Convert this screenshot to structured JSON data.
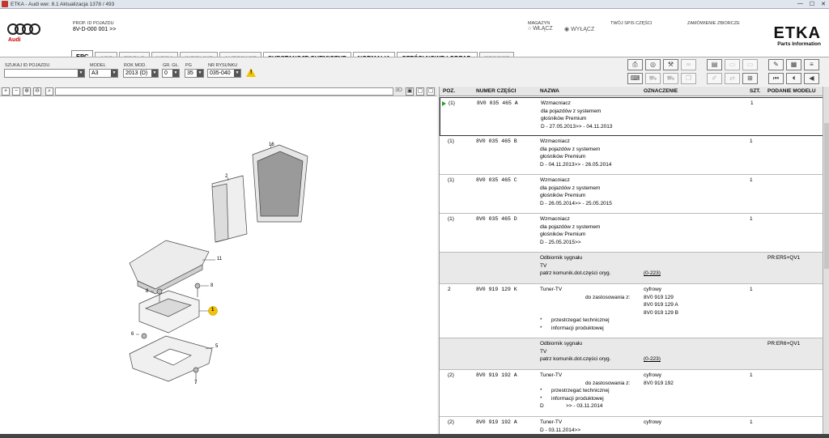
{
  "window": {
    "title": "ETKA - Audi wer. 8.1 Aktualizacja 1378 / 493",
    "controls": [
      "—",
      "☐",
      "✕"
    ]
  },
  "brand": {
    "audi": "Audi",
    "etka": "ETKA",
    "etka_sub": "Parts Information"
  },
  "header": {
    "prop_label": "PROP. ID POJAZDU",
    "prop_value": "8V-D-000 001 >>",
    "magazyn_label": "MAGAZYN",
    "wlacz": "WŁĄCZ",
    "wylacz": "WYŁĄCZ",
    "spis_label": "TWÓJ SPIS CZĘŚCI",
    "zamowienie_label": "ZAMÓWIENIE ZBIORCZE"
  },
  "tabs": [
    {
      "label": "EPC",
      "active": true,
      "enabled": true
    },
    {
      "label": "ACC",
      "enabled": false
    },
    {
      "label": "TOOLS",
      "enabled": false
    },
    {
      "label": "NORA",
      "enabled": false
    },
    {
      "label": "INFOLINE",
      "enabled": false
    },
    {
      "label": "AUTOPART",
      "enabled": false
    },
    {
      "label": "SUBSTANCJE CHEMICZNE",
      "enabled": true
    },
    {
      "label": "NORMALIA",
      "enabled": true
    },
    {
      "label": "CZĘŚCI NOWE I ODPAD.",
      "enabled": true
    },
    {
      "label": "REPORT",
      "enabled": false
    }
  ],
  "filters": {
    "szukaj_label": "SZUKAJ ID POJAZDU",
    "szukaj_value": "",
    "model_label": "MODEL",
    "model_value": "A3",
    "rok_label": "ROK MOD.",
    "rok_value": "2013 (D)",
    "gr_label": "GR. GŁ.",
    "gr_value": "0",
    "pg_label": "PG",
    "pg_value": "35",
    "nr_label": "NR RYSUNKU",
    "nr_value": "035-040"
  },
  "imagebar": {
    "label_3d": "3D"
  },
  "columns": {
    "poz": "POZ.",
    "numer": "NUMER CZĘŚCI",
    "nazwa": "NAZWA",
    "oznaczenie": "OZNACZENIE",
    "szt": "SZT.",
    "podanie": "PODANIE MODELU"
  },
  "rows": [
    {
      "poz": "(1)",
      "numer": "8V0  035  465  A",
      "nazwa": [
        "Wzmacniacz",
        "dla pojazdów z systemem",
        "głośników Premium",
        "D - 27.05.2013>> - 04.11.2013"
      ],
      "szt": "1",
      "selected": true
    },
    {
      "poz": "(1)",
      "numer": "8V0  035  465  B",
      "nazwa": [
        "Wzmacniacz",
        "dla pojazdów z systemem",
        "głośników Premium",
        "D - 04.11.2013>> - 26.05.2014"
      ],
      "szt": "1"
    },
    {
      "poz": "(1)",
      "numer": "8V0  035  465  C",
      "nazwa": [
        "Wzmacniacz",
        "dla pojazdów z systemem",
        "głośników Premium",
        "D - 26.05.2014>> - 25.05.2015"
      ],
      "szt": "1"
    },
    {
      "poz": "(1)",
      "numer": "8V0  035  465  D",
      "nazwa": [
        "Wzmacniacz",
        "dla pojazdów z systemem",
        "głośników Premium",
        "D - 25.05.2015>>"
      ],
      "szt": "1"
    },
    {
      "grey": true,
      "nazwa": [
        "Odbiornik sygnału",
        "TV",
        "patrz komunik.dot.części oryg."
      ],
      "link": "(0-223)",
      "podanie": "PR:ER5+QV1"
    },
    {
      "poz": "2",
      "numer": "8V0  919  129  K",
      "nazwa": [
        "Tuner-TV"
      ],
      "sub": "do zastosowania z:",
      "ozn": [
        "cyfrowy",
        "8V0 919 129",
        "8V0 919 129 A",
        "8V0 919 129 B"
      ],
      "notes": [
        "przestrzegać technicznej",
        "informacji produktowej"
      ],
      "szt": "1"
    },
    {
      "grey": true,
      "nazwa": [
        "Odbiornik sygnału",
        "TV",
        "patrz komunik.dot.części oryg."
      ],
      "link": "(0-223)",
      "podanie": "PR:ER6+QV1"
    },
    {
      "poz": "(2)",
      "numer": "8V0  919  192  A",
      "nazwa": [
        "Tuner-TV"
      ],
      "sub": "do zastosowania z:",
      "ozn": [
        "cyfrowy",
        "8V0 919 192"
      ],
      "notes": [
        "przestrzegać technicznej",
        "informacji produktowej"
      ],
      "tail": [
        "D",
        ">> - 03.11.2014"
      ],
      "szt": "1"
    },
    {
      "poz": "(2)",
      "numer": "8V0  919  192  A",
      "nazwa": [
        "Tuner-TV",
        "D - 03.11.2014>>"
      ],
      "ozn": [
        "cyfrowy"
      ],
      "szt": "1"
    }
  ],
  "diagram": {
    "callouts": [
      "16",
      "2",
      "11",
      "8",
      "8",
      "1",
      "6",
      "5",
      "7"
    ]
  },
  "colors": {
    "accent_marker": "#2a9d2a",
    "callout_highlight": "#f2c300",
    "warning": "#f2c300"
  }
}
